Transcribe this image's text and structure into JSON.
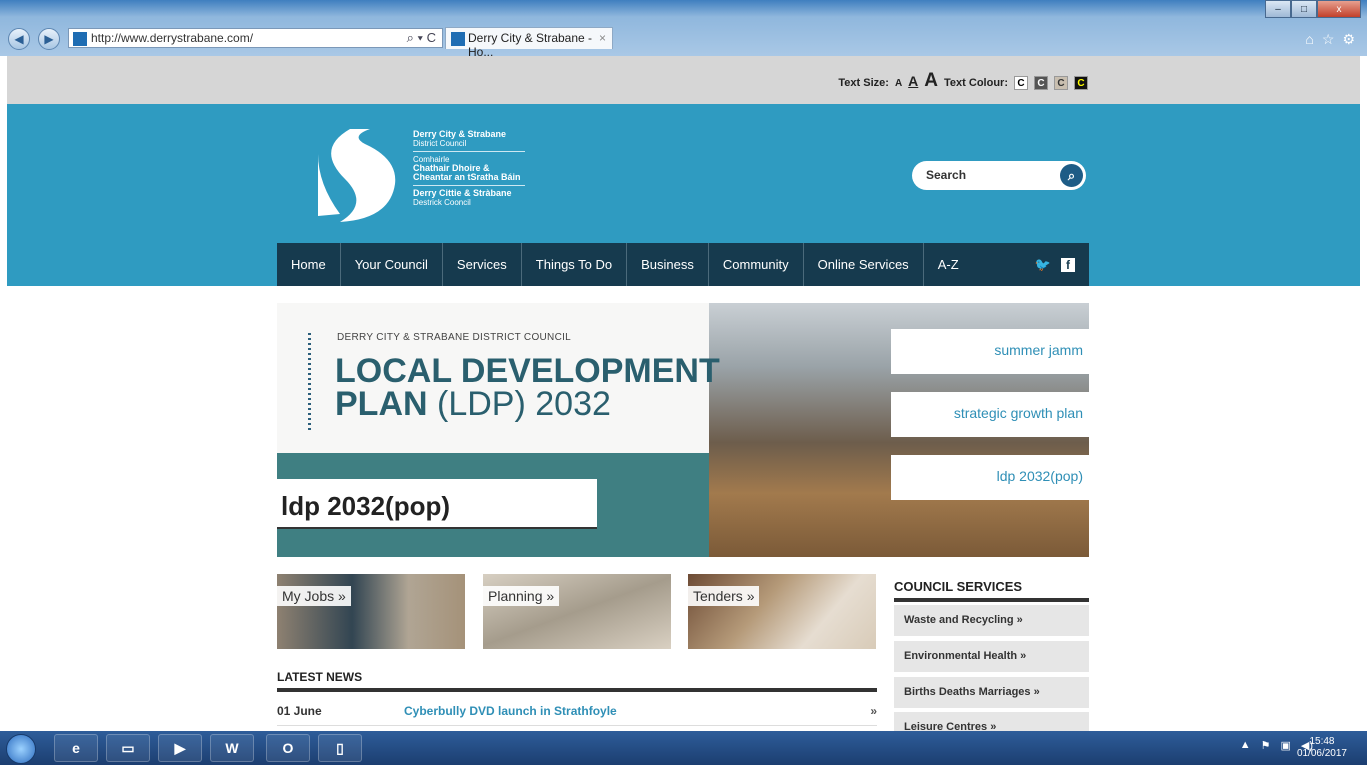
{
  "browser": {
    "url": "http://www.derrystrabane.com/",
    "tab_title": "Derry City & Strabane - Ho...",
    "tab_close": "×",
    "search_controls": "⌕ ▾ C",
    "win_min": "–",
    "win_max": "□",
    "win_close": "x"
  },
  "accessibility": {
    "text_size_label": "Text Size:",
    "size_small": "A",
    "size_medium": "A",
    "size_large": "A",
    "text_colour_label": "Text Colour:",
    "colour_options": [
      "C",
      "C",
      "C",
      "C"
    ]
  },
  "header": {
    "brand_line1": "Derry City & Strabane",
    "brand_line2": "District Council",
    "brand_line3": "Comhairle",
    "brand_line4": "Chathair Dhoire &",
    "brand_line5": "Cheantar an tSratha Báin",
    "brand_line6": "Derry Cittie & Stràbane",
    "brand_line7": "Destrick Cooncil",
    "search_placeholder": "Search"
  },
  "nav": {
    "items": [
      "Home",
      "Your Council",
      "Services",
      "Things To Do",
      "Business",
      "Community",
      "Online Services",
      "A-Z"
    ]
  },
  "hero": {
    "org": "DERRY CITY & STRABANE DISTRICT COUNCIL",
    "title_line1": "LOCAL DEVELOPMENT",
    "title_bold2": "PLAN",
    "title_light2": "(LDP) 2032",
    "caption": "ldp 2032(pop)",
    "slides": [
      "summer jamm",
      "strategic growth plan",
      "ldp 2032(pop)"
    ]
  },
  "tiles": [
    "My Jobs »",
    "Planning »",
    "Tenders »"
  ],
  "news": {
    "title": "LATEST NEWS",
    "items": [
      {
        "date": "01 June",
        "headline": "Cyberbully DVD launch in Strathfoyle",
        "more": "»"
      }
    ]
  },
  "council_services": {
    "title": "COUNCIL SERVICES",
    "items": [
      "Waste and Recycling »",
      "Environmental Health »",
      "Births Deaths Marriages »",
      "Leisure Centres »"
    ]
  },
  "taskbar": {
    "time": "15:48",
    "date": "01/06/2017",
    "word_label": "W",
    "outlook_label": "O"
  }
}
